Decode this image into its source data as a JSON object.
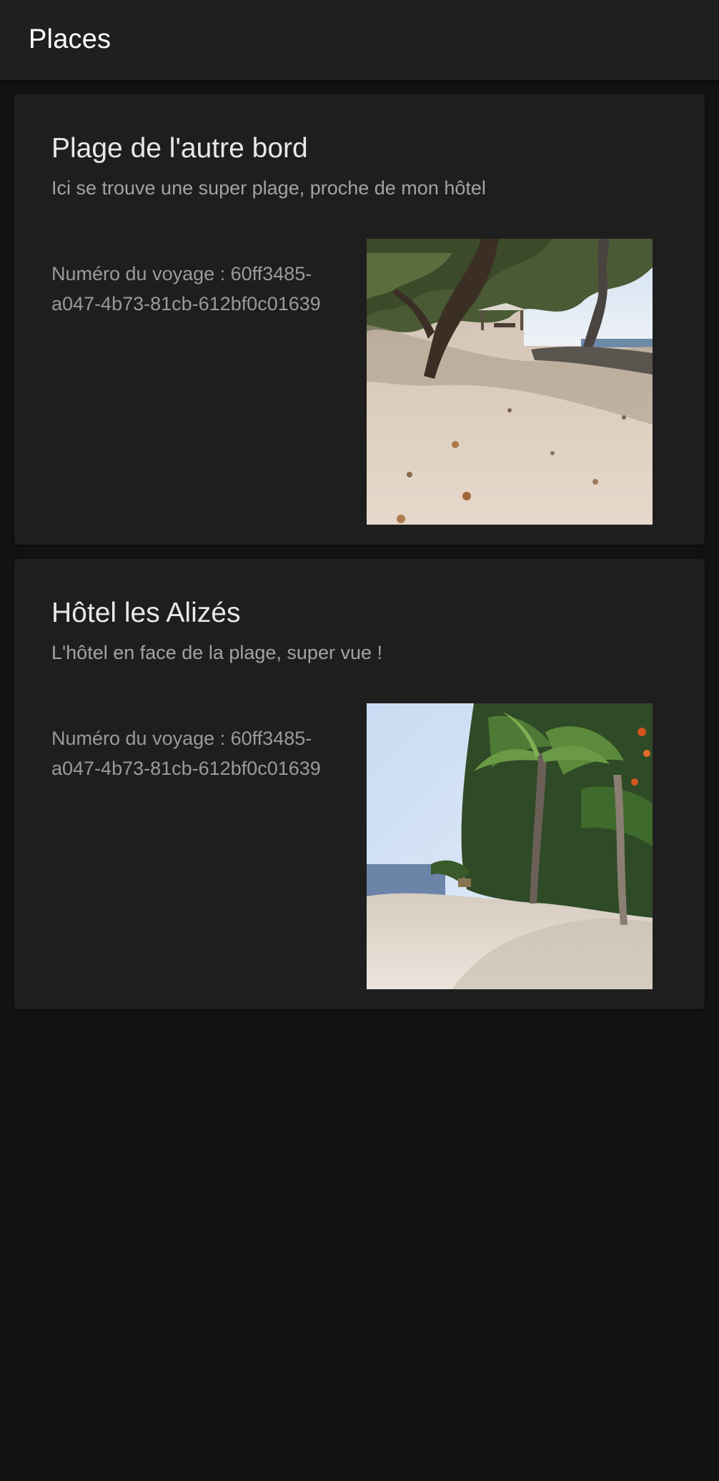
{
  "header": {
    "title": "Places"
  },
  "places": [
    {
      "title": "Plage de l'autre bord",
      "subtitle": "Ici se trouve une super plage, proche de mon hôtel",
      "trip_label": "Numéro du voyage : 60ff3485-a047-4b73-81cb-612bf0c01639",
      "image_icon": "beach-photo"
    },
    {
      "title": "Hôtel les Alizés",
      "subtitle": "L'hôtel en face de la plage, super vue !",
      "trip_label": "Numéro du voyage : 60ff3485-a047-4b73-81cb-612bf0c01639",
      "image_icon": "beach-palms-photo"
    }
  ],
  "colors": {
    "background": "#121212",
    "toolbar": "#1f1f1f",
    "card": "#1e1e1e",
    "title_text": "#e8e8e8",
    "secondary_text": "#a3a3a3"
  }
}
